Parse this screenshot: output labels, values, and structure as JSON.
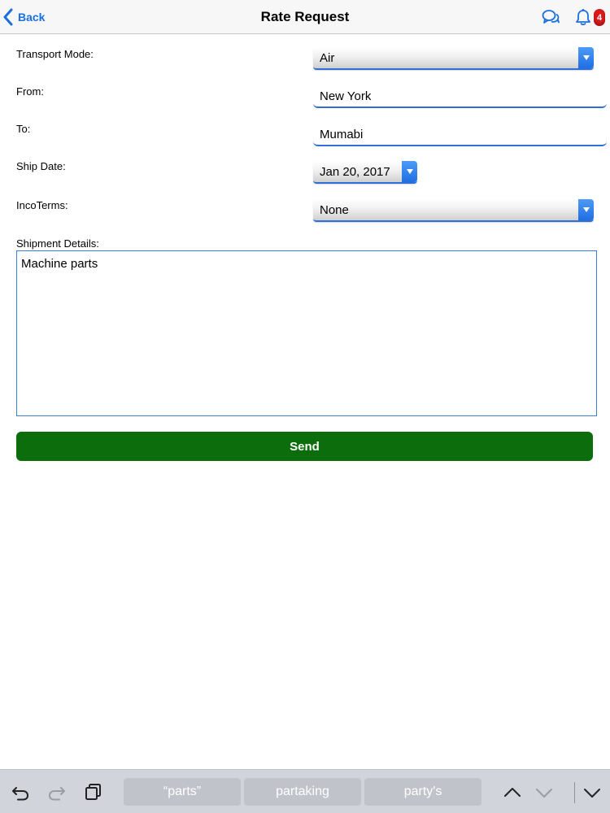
{
  "nav": {
    "back_label": "Back",
    "title": "Rate Request",
    "notification_count": "4",
    "accent_color": "#1a6fe0",
    "badge_color": "#d91b1b"
  },
  "form": {
    "transport_mode": {
      "label": "Transport Mode:",
      "value": "Air"
    },
    "from": {
      "label": "From:",
      "value": "New York"
    },
    "to": {
      "label": "To:",
      "value": "Mumabi"
    },
    "ship_date": {
      "label": "Ship Date:",
      "value": "Jan 20, 2017"
    },
    "incoterms": {
      "label": "IncoTerms:",
      "value": "None"
    },
    "shipment_details": {
      "label": "Shipment Details:",
      "value": "Machine parts"
    },
    "send_label": "Send",
    "send_color": "#0b6d0b"
  },
  "keyboard_bar": {
    "icons": [
      "undo-icon",
      "redo-icon",
      "paste-icon",
      "chevron-up-icon",
      "chevron-down-icon",
      "dismiss-keyboard-icon"
    ],
    "suggestions": [
      "“parts”",
      "partaking",
      "party's"
    ]
  }
}
